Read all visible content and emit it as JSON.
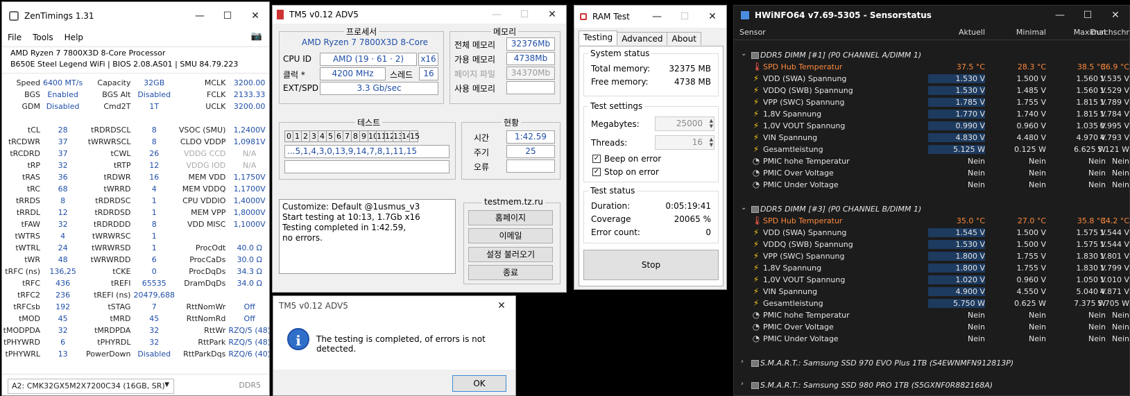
{
  "zen": {
    "title": "ZenTimings 1.31",
    "menu": [
      "File",
      "Tools",
      "Help"
    ],
    "cpu": "AMD Ryzen 7 7800X3D 8-Core Processor",
    "board": "B650E Steel Legend WiFi | BIOS 2.08.AS01 | SMU 84.79.223",
    "rows": [
      [
        "Speed",
        "6400 MT/s",
        "Capacity",
        "32GB",
        "MCLK",
        "3200.00"
      ],
      [
        "BGS",
        "Enabled",
        "BGS Alt",
        "Disabled",
        "FCLK",
        "2133.33"
      ],
      [
        "GDM",
        "Disabled",
        "Cmd2T",
        "1T",
        "UCLK",
        "3200.00"
      ],
      [
        "",
        "",
        "",
        "",
        "",
        ""
      ],
      [
        "tCL",
        "28",
        "tRDRDSCL",
        "8",
        "VSOC (SMU)",
        "1,2400V"
      ],
      [
        "tRCDWR",
        "37",
        "tWRWRSCL",
        "8",
        "CLDO VDDP",
        "1,0981V"
      ],
      [
        "tRCDRD",
        "37",
        "tCWL",
        "26",
        "VDDG CCD",
        "N/A"
      ],
      [
        "tRP",
        "32",
        "tRTP",
        "12",
        "VDDG IOD",
        "N/A"
      ],
      [
        "tRAS",
        "36",
        "tRDWR",
        "16",
        "MEM VDD",
        "1,1750V"
      ],
      [
        "tRC",
        "68",
        "tWRRD",
        "4",
        "MEM VDDQ",
        "1,1700V"
      ],
      [
        "tRRDS",
        "8",
        "tRDRDSC",
        "1",
        "CPU VDDIO",
        "1,4000V"
      ],
      [
        "tRRDL",
        "12",
        "tRDRDSD",
        "1",
        "MEM VPP",
        "1,8000V"
      ],
      [
        "tFAW",
        "32",
        "tRDRDDD",
        "8",
        "VDD MISC",
        "1,1000V"
      ],
      [
        "tWTRS",
        "4",
        "tWRWRSC",
        "1",
        "",
        ""
      ],
      [
        "tWTRL",
        "24",
        "tWRWRSD",
        "1",
        "ProcOdt",
        "40.0 Ω"
      ],
      [
        "tWR",
        "48",
        "tWRWRDD",
        "6",
        "ProcCaDs",
        "30.0 Ω"
      ],
      [
        "tRFC (ns)",
        "136,25",
        "tCKE",
        "0",
        "ProcDqDs",
        "34.3 Ω"
      ],
      [
        "tRFC",
        "436",
        "tREFI",
        "65535",
        "DramDqDs",
        "34.0 Ω"
      ],
      [
        "tRFC2",
        "236",
        "tREFI (ns)",
        "20479,688",
        "",
        ""
      ],
      [
        "tRFCsb",
        "192",
        "tSTAG",
        "7",
        "RttNomWr",
        "Off"
      ],
      [
        "tMOD",
        "45",
        "tMRD",
        "45",
        "RttNomRd",
        "Off"
      ],
      [
        "tMODPDA",
        "32",
        "tMRDPDA",
        "32",
        "RttWr",
        "RZQ/5 (48)"
      ],
      [
        "tPHYWRD",
        "6",
        "tPHYRDL",
        "32",
        "RttPark",
        "RZQ/5 (48)"
      ],
      [
        "tPHYWRL",
        "13",
        "PowerDown",
        "Disabled",
        "RttParkDqs",
        "RZQ/6 (40)"
      ]
    ],
    "module": "A2: CMK32GX5M2X7200C34 (16GB, SR)",
    "ddr": "DDR5"
  },
  "tm5": {
    "title": "TM5 v0.12 ADV5",
    "proc_h": "프로세서",
    "mem_h": "메모리",
    "cpu_name": "AMD Ryzen 7 7800X3D 8-Core",
    "cpuid_l": "CPU ID",
    "cpuid": "AMD  (19 · 61 · 2)",
    "threads_x": "x16",
    "clock_l": "클럭 *",
    "clock": "4200 MHz",
    "thread_l": "스레드",
    "thread": "16",
    "ext_l": "EXT/SPD",
    "ext": "3.3 Gb/sec",
    "total_l": "전체 메모리",
    "total": "32376Mb",
    "avail_l": "가용 메모리",
    "avail": "4738Mb",
    "page_l": "페이지 파일",
    "page": "34370Mb",
    "used_l": "사용 메모리",
    "test_h": "테스트",
    "status_h": "현황",
    "cells": [
      "0",
      "1",
      "2",
      "3",
      "4",
      "5",
      "6",
      "7",
      "8",
      "9",
      "10",
      "11",
      "12",
      "13",
      "14",
      "15"
    ],
    "sequence": "...5,1,4,3,0,13,9,14,7,8,1,11,15",
    "time_l": "시간",
    "time": "1:42.59",
    "cycle_l": "주기",
    "cycle": "25",
    "err_l": "오류",
    "log": [
      "Customize: Default @1usmus_v3",
      "Start testing at 10:13, 1.7Gb x16",
      "Testing completed in 1:42.59,",
      "no errors."
    ],
    "brand": "testmem.tz.ru",
    "btn_home": "홈페이지",
    "btn_mail": "이메일",
    "btn_load": "설정 불러오기",
    "btn_exit": "종료"
  },
  "ram": {
    "title": "RAM Test",
    "tabs": [
      "Testing",
      "Advanced",
      "About"
    ],
    "sys_h": "System status",
    "total_l": "Total memory:",
    "total": "32375 MB",
    "free_l": "Free memory:",
    "free": "4738 MB",
    "set_h": "Test settings",
    "mb_l": "Megabytes:",
    "mb": "25000",
    "thr_l": "Threads:",
    "thr": "16",
    "beep": "Beep on error",
    "stop_err": "Stop on error",
    "stat_h": "Test status",
    "dur_l": "Duration:",
    "dur": "0:05:19:41",
    "cov_l": "Coverage",
    "cov": "20065 %",
    "err_l": "Error count:",
    "err": "0",
    "stop": "Stop"
  },
  "dlg": {
    "title": "TM5 v0.12 ADV5",
    "msg": "The testing is completed, of errors is not detected.",
    "ok": "OK",
    "icon": "i"
  },
  "hw": {
    "title": "HWiNFO64 v7.69-5305 - Sensorstatus",
    "cols": [
      "Sensor",
      "Aktuell",
      "Minimal",
      "Maximal",
      "Durchschnitt"
    ],
    "g1": "DDR5 DIMM [#1] (P0 CHANNEL A/DIMM 1)",
    "g2": "DDR5 DIMM [#3] (P0 CHANNEL B/DIMM 1)",
    "rows1": [
      [
        "therm",
        "SPD Hub Temperatur",
        "37.5 °C",
        "28.3 °C",
        "38.5 °C",
        "36.9 °C"
      ],
      [
        "bolt",
        "VDD (SWA) Spannung",
        "1.530 V",
        "1.500 V",
        "1.560 V",
        "1.535 V"
      ],
      [
        "bolt",
        "VDDQ (SWB) Spannung",
        "1.530 V",
        "1.485 V",
        "1.560 V",
        "1.529 V"
      ],
      [
        "bolt",
        "VPP (SWC) Spannung",
        "1.785 V",
        "1.755 V",
        "1.815 V",
        "1.789 V"
      ],
      [
        "bolt",
        "1,8V Spannung",
        "1.770 V",
        "1.740 V",
        "1.815 V",
        "1.784 V"
      ],
      [
        "bolt",
        "1,0V VOUT Spannung",
        "0.990 V",
        "0.960 V",
        "1.035 V",
        "0.995 V"
      ],
      [
        "bolt",
        "VIN Spannung",
        "4.830 V",
        "4.480 V",
        "4.970 V",
        "4.793 V"
      ],
      [
        "bolt",
        "Gesamtleistung",
        "5.125 W",
        "0.125 W",
        "6.625 W",
        "5.121 W"
      ],
      [
        "circ",
        "PMIC hohe Temperatur",
        "Nein",
        "Nein",
        "Nein",
        "Nein"
      ],
      [
        "circ",
        "PMIC Over Voltage",
        "Nein",
        "Nein",
        "Nein",
        "Nein"
      ],
      [
        "circ",
        "PMIC Under Voltage",
        "Nein",
        "Nein",
        "Nein",
        "Nein"
      ]
    ],
    "rows2": [
      [
        "therm",
        "SPD Hub Temperatur",
        "35.0 °C",
        "27.0 °C",
        "35.8 °C",
        "34.2 °C"
      ],
      [
        "bolt",
        "VDD (SWA) Spannung",
        "1.545 V",
        "1.500 V",
        "1.575 V",
        "1.544 V"
      ],
      [
        "bolt",
        "VDDQ (SWB) Spannung",
        "1.530 V",
        "1.500 V",
        "1.575 V",
        "1.544 V"
      ],
      [
        "bolt",
        "VPP (SWC) Spannung",
        "1.800 V",
        "1.755 V",
        "1.830 V",
        "1.801 V"
      ],
      [
        "bolt",
        "1,8V Spannung",
        "1.800 V",
        "1.755 V",
        "1.830 V",
        "1.799 V"
      ],
      [
        "bolt",
        "1,0V VOUT Spannung",
        "1.020 V",
        "0.960 V",
        "1.050 V",
        "1.010 V"
      ],
      [
        "bolt",
        "VIN Spannung",
        "4.900 V",
        "4.550 V",
        "5.040 V",
        "4.871 V"
      ],
      [
        "bolt",
        "Gesamtleistung",
        "5.750 W",
        "0.625 W",
        "7.375 W",
        "5.705 W"
      ],
      [
        "circ",
        "PMIC hohe Temperatur",
        "Nein",
        "Nein",
        "Nein",
        "Nein"
      ],
      [
        "circ",
        "PMIC Over Voltage",
        "Nein",
        "Nein",
        "Nein",
        "Nein"
      ],
      [
        "circ",
        "PMIC Under Voltage",
        "Nein",
        "Nein",
        "Nein",
        "Nein"
      ]
    ],
    "g3": "S.M.A.R.T.: Samsung SSD 970 EVO Plus 1TB (S4EWNMFN912813P)",
    "g4": "S.M.A.R.T.: Samsung SSD 980 PRO 1TB (S5GXNF0R882168A)"
  }
}
